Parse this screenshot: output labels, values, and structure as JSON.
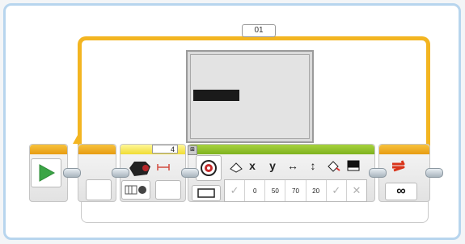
{
  "loop": {
    "label": "01"
  },
  "motor": {
    "power": "4"
  },
  "display": {
    "params": [
      "✓",
      "0",
      "50",
      "70",
      "20",
      "✓",
      "✕"
    ],
    "headers": [
      "x",
      "y",
      "↔",
      "↕"
    ]
  },
  "colors": {
    "loop_orange": "#f3b521",
    "display_green": "#8bc02a",
    "motor_yellow": "#f0dc34",
    "play_green": "#3ba546",
    "loop_red": "#d9341a",
    "frame_blue": "#b7d5ee"
  },
  "icons": [
    "play-triangle-icon",
    "motor-icon",
    "distance-icon",
    "rotation-wheel-icon",
    "mode-toggle-icon",
    "eraser-icon",
    "fill-icon",
    "color-swatch-icon",
    "loop-arrows-icon",
    "infinity-icon",
    "screen-toggle-icon"
  ],
  "loop_count_symbol": "∞"
}
